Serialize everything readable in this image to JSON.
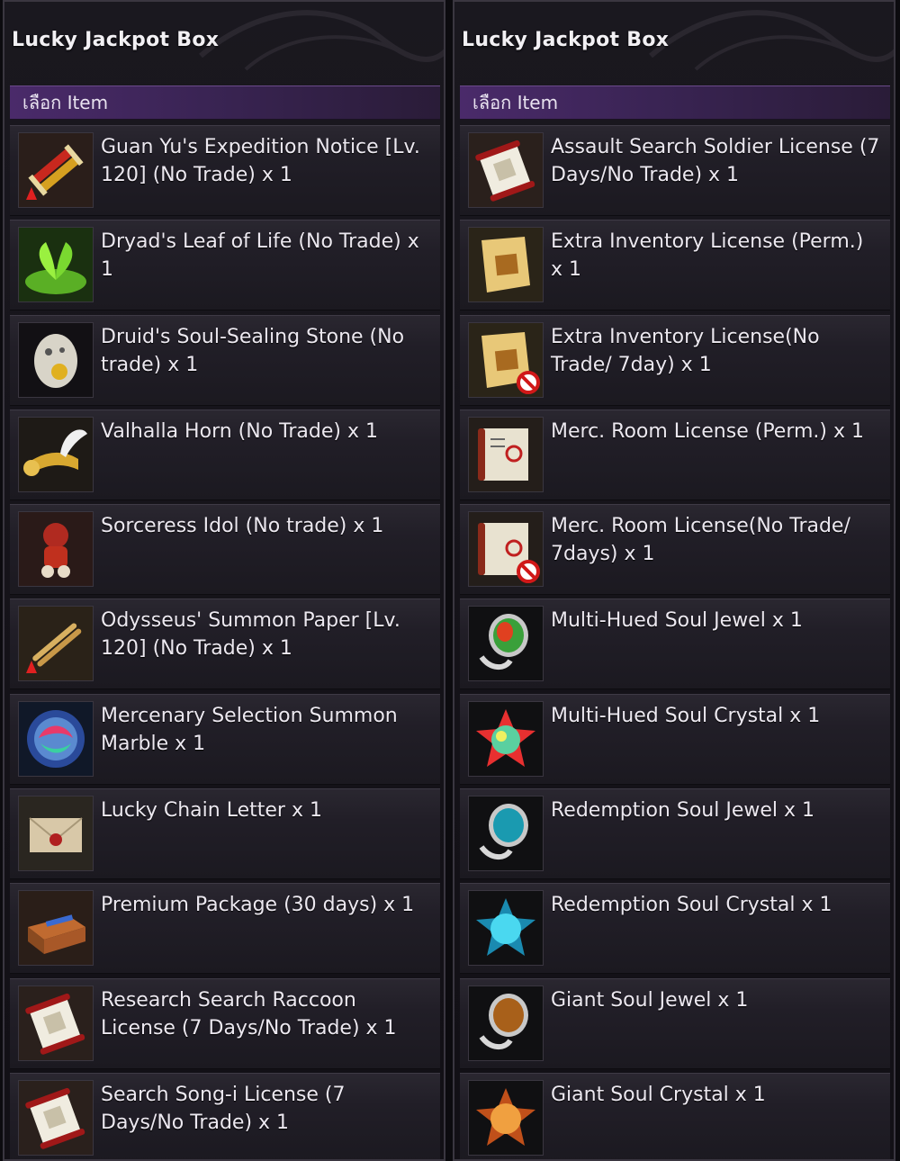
{
  "left_panel": {
    "title": "Lucky Jackpot Box",
    "header": "เลือก Item",
    "items": [
      {
        "label": "Guan Yu's Expedition Notice [Lv. 120] (No Trade) x 1",
        "icon": "scroll-bundle-icon"
      },
      {
        "label": "Dryad's Leaf of Life (No Trade) x 1",
        "icon": "green-leaf-icon"
      },
      {
        "label": "Druid's Soul-Sealing Stone (No trade) x 1",
        "icon": "soul-stone-icon"
      },
      {
        "label": "Valhalla Horn (No Trade) x 1",
        "icon": "winged-horn-icon"
      },
      {
        "label": "Sorceress Idol (No trade) x 1",
        "icon": "doll-icon"
      },
      {
        "label": "Odysseus' Summon Paper [Lv. 120] (No Trade) x 1",
        "icon": "summon-paper-icon"
      },
      {
        "label": "Mercenary Selection Summon Marble x 1",
        "icon": "marble-icon"
      },
      {
        "label": "Lucky Chain Letter x 1",
        "icon": "letter-icon"
      },
      {
        "label": "Premium Package (30 days) x 1",
        "icon": "package-box-icon"
      },
      {
        "label": "Research Search Raccoon License (7 Days/No Trade) x 1",
        "icon": "license-scroll-icon"
      },
      {
        "label": "Search Song-i License (7 Days/No Trade) x 1",
        "icon": "license-scroll-icon"
      }
    ]
  },
  "right_panel": {
    "title": "Lucky Jackpot Box",
    "header": "เลือก Item",
    "items": [
      {
        "label": "Assault Search Soldier License (7 Days/No Trade) x 1",
        "icon": "license-scroll-icon"
      },
      {
        "label": "Extra Inventory License (Perm.) x 1",
        "icon": "inventory-license-icon"
      },
      {
        "label": "Extra Inventory License(No Trade/ 7day) x 1",
        "icon": "inventory-license-notrade-icon"
      },
      {
        "label": "Merc. Room License (Perm.) x 1",
        "icon": "room-license-icon"
      },
      {
        "label": "Merc. Room License(No Trade/ 7days) x 1",
        "icon": "room-license-notrade-icon"
      },
      {
        "label": "Multi-Hued Soul Jewel x 1",
        "icon": "multi-jewel-icon"
      },
      {
        "label": "Multi-Hued Soul Crystal x 1",
        "icon": "multi-crystal-icon"
      },
      {
        "label": "Redemption Soul Jewel x 1",
        "icon": "blue-jewel-icon"
      },
      {
        "label": "Redemption Soul Crystal x 1",
        "icon": "blue-crystal-icon"
      },
      {
        "label": "Giant Soul Jewel x 1",
        "icon": "amber-jewel-icon"
      },
      {
        "label": "Giant Soul Crystal x 1",
        "icon": "amber-crystal-icon"
      }
    ]
  },
  "colors": {
    "panel_bg": "#1a181f",
    "header_purple": "#4a2a6a",
    "row_bg": "#2a2730",
    "text": "#ece8f0"
  }
}
